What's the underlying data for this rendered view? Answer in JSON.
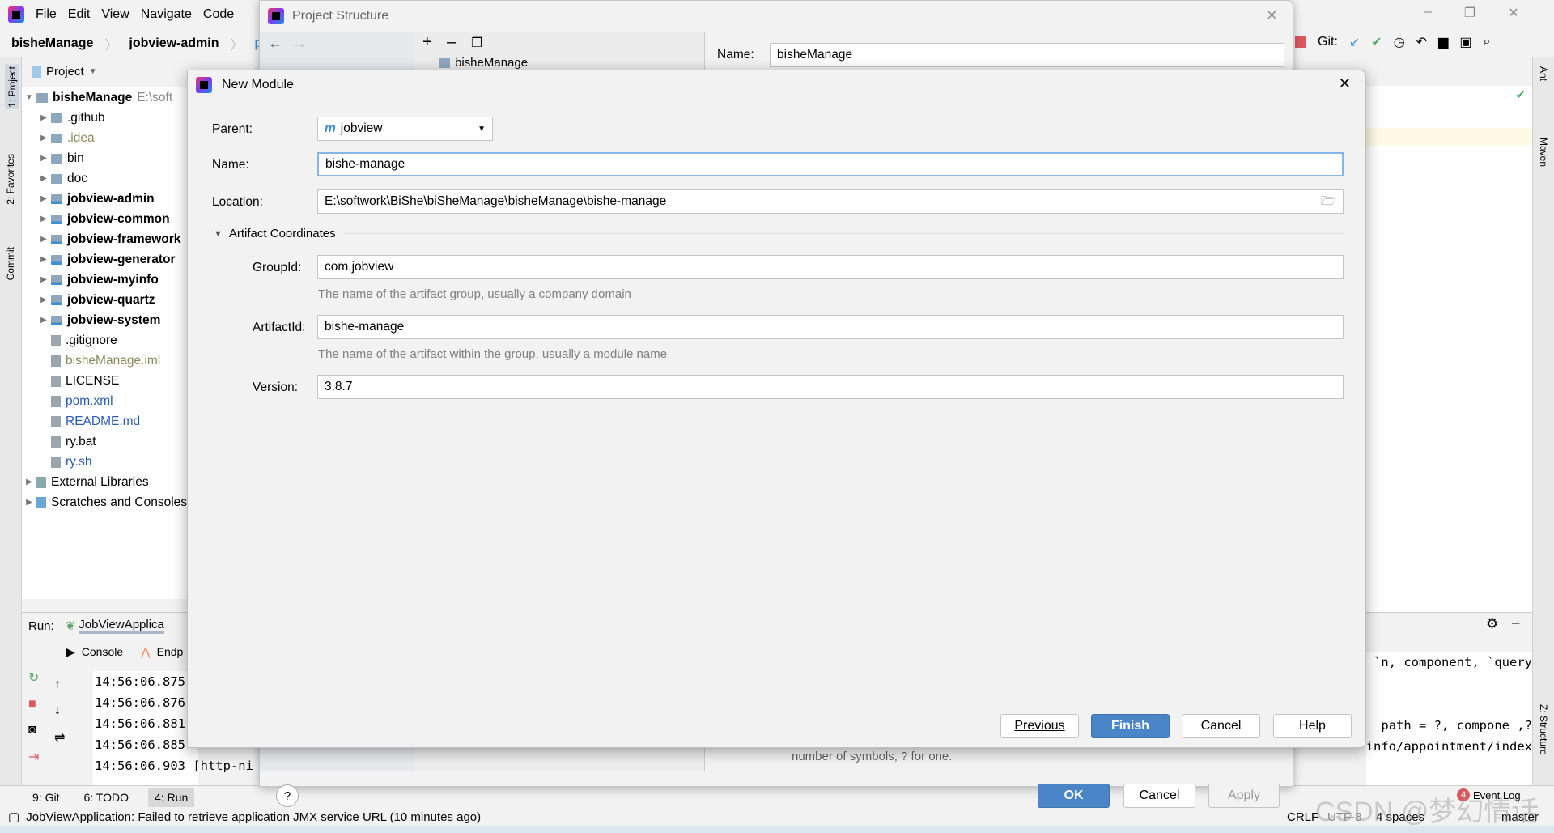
{
  "menu": {
    "items": [
      "File",
      "Edit",
      "View",
      "Navigate",
      "Code"
    ]
  },
  "breadcrumb": [
    "bisheManage",
    "jobview-admin",
    "pom"
  ],
  "window_controls": {
    "minimize": "–",
    "restore": "❐",
    "close": "✕"
  },
  "toolbar": {
    "git_label": "Git:"
  },
  "project_panel": {
    "title": "Project",
    "root": {
      "name": "bisheManage",
      "path": "E:\\soft"
    },
    "items": [
      {
        "label": ".github",
        "type": "folder",
        "bold": false
      },
      {
        "label": ".idea",
        "type": "folder",
        "bold": false,
        "muted": true
      },
      {
        "label": "bin",
        "type": "folder",
        "bold": false
      },
      {
        "label": "doc",
        "type": "folder",
        "bold": false
      },
      {
        "label": "jobview-admin",
        "type": "module",
        "bold": true
      },
      {
        "label": "jobview-common",
        "type": "module",
        "bold": true
      },
      {
        "label": "jobview-framework",
        "type": "module",
        "bold": true
      },
      {
        "label": "jobview-generator",
        "type": "module",
        "bold": true
      },
      {
        "label": "jobview-myinfo",
        "type": "module",
        "bold": true
      },
      {
        "label": "jobview-quartz",
        "type": "module",
        "bold": true
      },
      {
        "label": "jobview-system",
        "type": "module",
        "bold": true
      },
      {
        "label": ".gitignore",
        "type": "file"
      },
      {
        "label": "bisheManage.iml",
        "type": "file",
        "muted": true
      },
      {
        "label": "LICENSE",
        "type": "file"
      },
      {
        "label": "pom.xml",
        "type": "file",
        "blue": true
      },
      {
        "label": "README.md",
        "type": "file",
        "blue": true
      },
      {
        "label": "ry.bat",
        "type": "file"
      },
      {
        "label": "ry.sh",
        "type": "file",
        "blue": true
      }
    ],
    "external": "External Libraries",
    "scratches": "Scratches and Consoles"
  },
  "left_strip": [
    "1: Project",
    "2: Favorites",
    "Commit"
  ],
  "right_strip": [
    "Ant",
    "Maven",
    "Z: Structure"
  ],
  "run_panel": {
    "label": "Run:",
    "config": "JobViewApplica",
    "tabs": [
      "Console",
      "Endp"
    ],
    "log_lines": [
      "14:56:06.875",
      "14:56:06.876",
      "14:56:06.881",
      "14:56:06.885",
      "14:56:06.903 [http-ni"
    ],
    "right_lines": [
      "n, component, `query`",
      "?, path = ?, compone",
      "ing), myinfo/appointment/index"
    ]
  },
  "bottom_tools": [
    "9: Git",
    "6: TODO",
    "4: Run"
  ],
  "status": {
    "message": "JobViewApplication: Failed to retrieve application JMX service URL (10 minutes ago)",
    "line_sep": "CRLF",
    "encoding": "UTF-8",
    "indent": "4 spaces",
    "branch": "master",
    "event_log": "Event Log",
    "event_count": "4"
  },
  "watermark": "CSDN @梦幻情话",
  "project_structure": {
    "title": "Project Structure",
    "name_label": "Name:",
    "name_value": "bisheManage",
    "tree_item": "bisheManage",
    "hint": "number of symbols, ? for one.",
    "ok": "OK",
    "cancel": "Cancel",
    "apply": "Apply",
    "help": "?"
  },
  "new_module": {
    "title": "New Module",
    "parent_label": "Parent:",
    "parent_value": "jobview",
    "name_label": "Name:",
    "name_value": "bishe-manage",
    "location_label": "Location:",
    "location_value": "E:\\softwork\\BiShe\\biSheManage\\bisheManage\\bishe-manage",
    "section": "Artifact Coordinates",
    "groupid_label": "GroupId:",
    "groupid_value": "com.jobview",
    "groupid_hint": "The name of the artifact group, usually a company domain",
    "artifactid_label": "ArtifactId:",
    "artifactid_value": "bishe-manage",
    "artifactid_hint": "The name of the artifact within the group, usually a module name",
    "version_label": "Version:",
    "version_value": "3.8.7",
    "buttons": {
      "previous": "Previous",
      "finish": "Finish",
      "cancel": "Cancel",
      "help": "Help"
    }
  },
  "colors": {
    "accent": "#4a86c7",
    "focus": "#87b5e6",
    "stop": "#db5860",
    "ok_green": "#59a869"
  }
}
